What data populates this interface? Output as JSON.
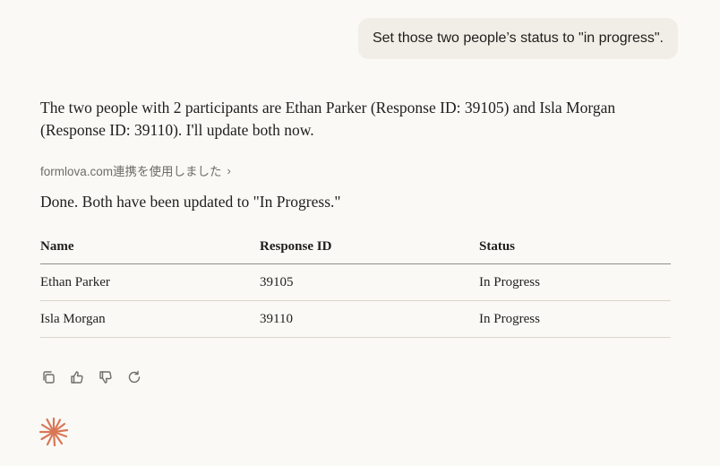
{
  "user_message": "Set those two people’s status to \"in progress\".",
  "assistant": {
    "intro": "The two people with 2 participants are Ethan Parker (Response ID: 39105) and Isla Morgan (Response ID: 39110). I'll update both now.",
    "tool_use_label": "formlova.com連携を使用しました",
    "done": "Done. Both have been updated to \"In Progress.\"",
    "table": {
      "headers": [
        "Name",
        "Response ID",
        "Status"
      ],
      "rows": [
        [
          "Ethan Parker",
          "39105",
          "In Progress"
        ],
        [
          "Isla Morgan",
          "39110",
          "In Progress"
        ]
      ]
    }
  },
  "icons": {
    "copy": "copy-icon",
    "thumbs_up": "thumbs-up-icon",
    "thumbs_down": "thumbs-down-icon",
    "retry": "retry-icon",
    "logo": "claude-spark-icon",
    "expand": "chevron-right-icon"
  },
  "colors": {
    "background": "#faf9f5",
    "user_bubble": "#f0eee6",
    "logo": "#d97757"
  }
}
